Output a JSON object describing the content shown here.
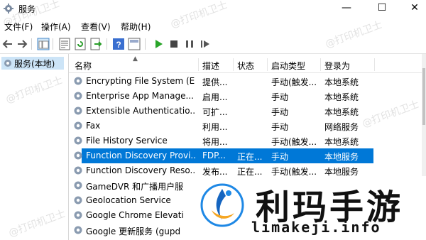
{
  "window": {
    "title": "服务",
    "minimize": "—",
    "maximize": "☐",
    "close": "✕"
  },
  "menu": [
    "文件(F)",
    "操作(A)",
    "查看(V)",
    "帮助(H)"
  ],
  "tree": {
    "root_label": "服务(本地)"
  },
  "table": {
    "columns": [
      "名称",
      "描述",
      "状态",
      "启动类型",
      "登录为"
    ],
    "rows": [
      {
        "name": "Encrypting File System (E...",
        "desc": "提供...",
        "status": "",
        "startup": "手动(触发...",
        "logon": "本地系统"
      },
      {
        "name": "Enterprise App Manage...",
        "desc": "启用...",
        "status": "",
        "startup": "手动",
        "logon": "本地系统"
      },
      {
        "name": "Extensible Authenticatio...",
        "desc": "可扩...",
        "status": "",
        "startup": "手动",
        "logon": "本地系统"
      },
      {
        "name": "Fax",
        "desc": "利用...",
        "status": "",
        "startup": "手动",
        "logon": "网络服务"
      },
      {
        "name": "File History Service",
        "desc": "将用...",
        "status": "",
        "startup": "手动(触发...",
        "logon": "本地系统"
      },
      {
        "name": "Function Discovery Provi...",
        "desc": "FDP...",
        "status": "正在...",
        "startup": "手动",
        "logon": "本地服务",
        "selected": true
      },
      {
        "name": "Function Discovery Reso...",
        "desc": "发布...",
        "status": "正在...",
        "startup": "手动(触发...",
        "logon": "本地服务"
      },
      {
        "name": "GameDVR 和广播用户服",
        "desc": "",
        "status": "",
        "startup": "",
        "logon": ""
      },
      {
        "name": "Geolocation Service",
        "desc": "",
        "status": "",
        "startup": "",
        "logon": ""
      },
      {
        "name": "Google Chrome Elevati",
        "desc": "",
        "status": "",
        "startup": "",
        "logon": ""
      },
      {
        "name": "Google 更新服务 (gupd",
        "desc": "",
        "status": "",
        "startup": "",
        "logon": ""
      }
    ]
  },
  "watermark": "@打印机卫士",
  "logo": {
    "cn": "利玛手游",
    "en": "limakeji.info",
    "accent": "#1e88e5"
  }
}
